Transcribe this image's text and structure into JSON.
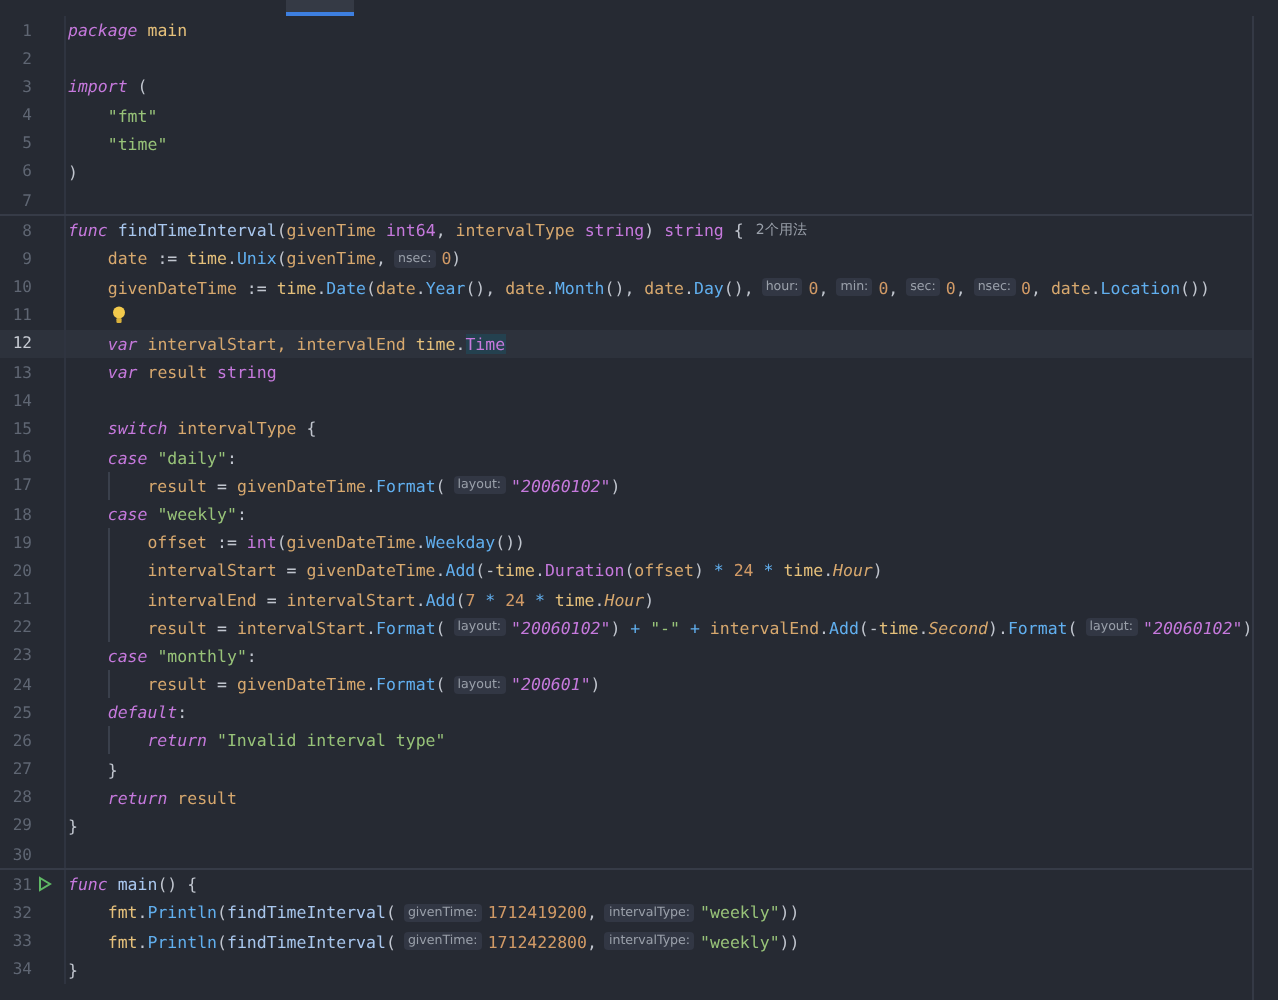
{
  "tab": {
    "selected": true
  },
  "blocks": [
    {
      "lines": [
        {
          "n": "1",
          "current": false,
          "tokens": [
            {
              "kind": "kw",
              "text": "package "
            },
            {
              "kind": "pk",
              "text": "main"
            }
          ]
        },
        {
          "n": "2",
          "current": false
        },
        {
          "n": "3",
          "current": false,
          "tokens": [
            {
              "kind": "kw",
              "text": "import "
            },
            {
              "kind": "pl",
              "text": "("
            }
          ],
          "children": [
            {
              "n": "4",
              "current": false,
              "tokens": [
                {
                  "kind": "str",
                  "text": "\"fmt\""
                }
              ]
            },
            {
              "n": "5",
              "current": false,
              "tokens": [
                {
                  "kind": "str",
                  "text": "\"time\""
                }
              ]
            }
          ]
        },
        {
          "n": "6",
          "current": false,
          "tokens": [
            {
              "kind": "pl",
              "text": ")"
            }
          ]
        },
        {
          "n": "7",
          "current": false
        }
      ]
    },
    {
      "lines": [
        {
          "n": "8",
          "current": false,
          "tokens": [
            {
              "kind": "kw",
              "text": "func "
            },
            {
              "kind": "decl",
              "text": "findTimeInterval"
            },
            {
              "kind": "pl",
              "text": "("
            },
            {
              "kind": "var",
              "text": "givenTime "
            },
            {
              "kind": "ty",
              "text": "int64"
            },
            {
              "kind": "pl",
              "text": ", "
            },
            {
              "kind": "var",
              "text": "intervalType "
            },
            {
              "kind": "ty",
              "text": "string"
            },
            {
              "kind": "pl",
              "text": ") "
            },
            {
              "kind": "ty",
              "text": "string "
            },
            {
              "kind": "pl",
              "text": "{"
            },
            {
              "kind": "usage",
              "text": "2个用法"
            }
          ],
          "children": [
            {
              "n": "9",
              "current": false,
              "tokens": [
                {
                  "kind": "var",
                  "text": "date "
                },
                {
                  "kind": "pl",
                  "text": ":= "
                },
                {
                  "kind": "pk",
                  "text": "time"
                },
                {
                  "kind": "pl",
                  "text": "."
                },
                {
                  "kind": "fn",
                  "text": "Unix"
                },
                {
                  "kind": "pl",
                  "text": "("
                },
                {
                  "kind": "var",
                  "text": "givenTime"
                },
                {
                  "kind": "pl",
                  "text": ","
                },
                {
                  "kind": "hint",
                  "text": "nsec:"
                },
                {
                  "kind": "num",
                  "text": "0"
                },
                {
                  "kind": "pl",
                  "text": ")"
                }
              ]
            },
            {
              "n": "10",
              "current": false,
              "tokens": [
                {
                  "kind": "var",
                  "text": "givenDateTime "
                },
                {
                  "kind": "pl",
                  "text": ":= "
                },
                {
                  "kind": "pk",
                  "text": "time"
                },
                {
                  "kind": "pl",
                  "text": "."
                },
                {
                  "kind": "fn",
                  "text": "Date"
                },
                {
                  "kind": "pl",
                  "text": "("
                },
                {
                  "kind": "var",
                  "text": "date"
                },
                {
                  "kind": "pl",
                  "text": "."
                },
                {
                  "kind": "fn",
                  "text": "Year"
                },
                {
                  "kind": "pl",
                  "text": "(), "
                },
                {
                  "kind": "var",
                  "text": "date"
                },
                {
                  "kind": "pl",
                  "text": "."
                },
                {
                  "kind": "fn",
                  "text": "Month"
                },
                {
                  "kind": "pl",
                  "text": "(), "
                },
                {
                  "kind": "var",
                  "text": "date"
                },
                {
                  "kind": "pl",
                  "text": "."
                },
                {
                  "kind": "fn",
                  "text": "Day"
                },
                {
                  "kind": "pl",
                  "text": "(),"
                },
                {
                  "kind": "hint",
                  "text": "hour:"
                },
                {
                  "kind": "num",
                  "text": "0"
                },
                {
                  "kind": "pl",
                  "text": ","
                },
                {
                  "kind": "hint",
                  "text": "min:"
                },
                {
                  "kind": "num",
                  "text": "0"
                },
                {
                  "kind": "pl",
                  "text": ","
                },
                {
                  "kind": "hint",
                  "text": "sec:"
                },
                {
                  "kind": "num",
                  "text": "0"
                },
                {
                  "kind": "pl",
                  "text": ","
                },
                {
                  "kind": "hint",
                  "text": "nsec:"
                },
                {
                  "kind": "num",
                  "text": "0"
                },
                {
                  "kind": "pl",
                  "text": ", "
                },
                {
                  "kind": "var",
                  "text": "date"
                },
                {
                  "kind": "pl",
                  "text": "."
                },
                {
                  "kind": "fn",
                  "text": "Location"
                },
                {
                  "kind": "pl",
                  "text": "())"
                }
              ]
            },
            {
              "n": "11",
              "current": false,
              "kind": "bulb"
            },
            {
              "n": "12",
              "current": true,
              "tokens": [
                {
                  "kind": "kw",
                  "text": "var "
                },
                {
                  "kind": "var",
                  "text": "intervalStart, intervalEnd "
                },
                {
                  "kind": "pk",
                  "text": "time"
                },
                {
                  "kind": "pl",
                  "text": "."
                },
                {
                  "kind": "tyhl",
                  "text": "Time"
                }
              ]
            },
            {
              "n": "13",
              "current": false,
              "tokens": [
                {
                  "kind": "kw",
                  "text": "var "
                },
                {
                  "kind": "var",
                  "text": "result "
                },
                {
                  "kind": "ty",
                  "text": "string"
                }
              ]
            },
            {
              "n": "14",
              "current": false
            },
            {
              "n": "15",
              "current": false,
              "tokens": [
                {
                  "kind": "kw",
                  "text": "switch "
                },
                {
                  "kind": "var",
                  "text": "intervalType "
                },
                {
                  "kind": "pl",
                  "text": "{"
                }
              ]
            },
            {
              "n": "16",
              "current": false,
              "tokens": [
                {
                  "kind": "kw",
                  "text": "case "
                },
                {
                  "kind": "str",
                  "text": "\"daily\""
                },
                {
                  "kind": "pl",
                  "text": ":"
                }
              ],
              "children": [
                {
                  "n": "17",
                  "current": false,
                  "tokens": [
                    {
                      "kind": "var",
                      "text": "result "
                    },
                    {
                      "kind": "pl",
                      "text": "= "
                    },
                    {
                      "kind": "var",
                      "text": "givenDateTime"
                    },
                    {
                      "kind": "pl",
                      "text": "."
                    },
                    {
                      "kind": "fn",
                      "text": "Format"
                    },
                    {
                      "kind": "pl",
                      "text": "("
                    },
                    {
                      "kind": "hint",
                      "text": "layout:"
                    },
                    {
                      "kind": "fstr",
                      "text": "\"20060102\""
                    },
                    {
                      "kind": "pl",
                      "text": ")"
                    }
                  ]
                }
              ]
            },
            {
              "n": "18",
              "current": false,
              "tokens": [
                {
                  "kind": "kw",
                  "text": "case "
                },
                {
                  "kind": "str",
                  "text": "\"weekly\""
                },
                {
                  "kind": "pl",
                  "text": ":"
                }
              ],
              "children": [
                {
                  "n": "19",
                  "current": false,
                  "tokens": [
                    {
                      "kind": "var",
                      "text": "offset "
                    },
                    {
                      "kind": "pl",
                      "text": ":= "
                    },
                    {
                      "kind": "ty",
                      "text": "int"
                    },
                    {
                      "kind": "pl",
                      "text": "("
                    },
                    {
                      "kind": "var",
                      "text": "givenDateTime"
                    },
                    {
                      "kind": "pl",
                      "text": "."
                    },
                    {
                      "kind": "fn",
                      "text": "Weekday"
                    },
                    {
                      "kind": "pl",
                      "text": "())"
                    }
                  ]
                },
                {
                  "n": "20",
                  "current": false,
                  "tokens": [
                    {
                      "kind": "var",
                      "text": "intervalStart "
                    },
                    {
                      "kind": "pl",
                      "text": "= "
                    },
                    {
                      "kind": "var",
                      "text": "givenDateTime"
                    },
                    {
                      "kind": "pl",
                      "text": "."
                    },
                    {
                      "kind": "fn",
                      "text": "Add"
                    },
                    {
                      "kind": "pl",
                      "text": "(-"
                    },
                    {
                      "kind": "pk",
                      "text": "time"
                    },
                    {
                      "kind": "pl",
                      "text": "."
                    },
                    {
                      "kind": "ty",
                      "text": "Duration"
                    },
                    {
                      "kind": "pl",
                      "text": "("
                    },
                    {
                      "kind": "var",
                      "text": "offset"
                    },
                    {
                      "kind": "pl",
                      "text": ") "
                    },
                    {
                      "kind": "op",
                      "text": "* "
                    },
                    {
                      "kind": "num",
                      "text": "24 "
                    },
                    {
                      "kind": "op",
                      "text": "* "
                    },
                    {
                      "kind": "pk",
                      "text": "time"
                    },
                    {
                      "kind": "pl",
                      "text": "."
                    },
                    {
                      "kind": "con",
                      "text": "Hour"
                    },
                    {
                      "kind": "pl",
                      "text": ")"
                    }
                  ]
                },
                {
                  "n": "21",
                  "current": false,
                  "tokens": [
                    {
                      "kind": "var",
                      "text": "intervalEnd "
                    },
                    {
                      "kind": "pl",
                      "text": "= "
                    },
                    {
                      "kind": "var",
                      "text": "intervalStart"
                    },
                    {
                      "kind": "pl",
                      "text": "."
                    },
                    {
                      "kind": "fn",
                      "text": "Add"
                    },
                    {
                      "kind": "pl",
                      "text": "("
                    },
                    {
                      "kind": "num",
                      "text": "7 "
                    },
                    {
                      "kind": "op",
                      "text": "* "
                    },
                    {
                      "kind": "num",
                      "text": "24 "
                    },
                    {
                      "kind": "op",
                      "text": "* "
                    },
                    {
                      "kind": "pk",
                      "text": "time"
                    },
                    {
                      "kind": "pl",
                      "text": "."
                    },
                    {
                      "kind": "con",
                      "text": "Hour"
                    },
                    {
                      "kind": "pl",
                      "text": ")"
                    }
                  ]
                },
                {
                  "n": "22",
                  "current": false,
                  "tokens": [
                    {
                      "kind": "var",
                      "text": "result "
                    },
                    {
                      "kind": "pl",
                      "text": "= "
                    },
                    {
                      "kind": "var",
                      "text": "intervalStart"
                    },
                    {
                      "kind": "pl",
                      "text": "."
                    },
                    {
                      "kind": "fn",
                      "text": "Format"
                    },
                    {
                      "kind": "pl",
                      "text": "("
                    },
                    {
                      "kind": "hint",
                      "text": "layout:"
                    },
                    {
                      "kind": "fstr",
                      "text": "\"20060102\""
                    },
                    {
                      "kind": "pl",
                      "text": ") "
                    },
                    {
                      "kind": "op",
                      "text": "+ "
                    },
                    {
                      "kind": "str",
                      "text": "\"-\" "
                    },
                    {
                      "kind": "op",
                      "text": "+ "
                    },
                    {
                      "kind": "var",
                      "text": "intervalEnd"
                    },
                    {
                      "kind": "pl",
                      "text": "."
                    },
                    {
                      "kind": "fn",
                      "text": "Add"
                    },
                    {
                      "kind": "pl",
                      "text": "(-"
                    },
                    {
                      "kind": "pk",
                      "text": "time"
                    },
                    {
                      "kind": "pl",
                      "text": "."
                    },
                    {
                      "kind": "con",
                      "text": "Second"
                    },
                    {
                      "kind": "pl",
                      "text": ")."
                    },
                    {
                      "kind": "fn",
                      "text": "Format"
                    },
                    {
                      "kind": "pl",
                      "text": "("
                    },
                    {
                      "kind": "hint",
                      "text": "layout:"
                    },
                    {
                      "kind": "fstr",
                      "text": "\"20060102\""
                    },
                    {
                      "kind": "pl",
                      "text": ")"
                    }
                  ]
                }
              ]
            },
            {
              "n": "23",
              "current": false,
              "tokens": [
                {
                  "kind": "kw",
                  "text": "case "
                },
                {
                  "kind": "str",
                  "text": "\"monthly\""
                },
                {
                  "kind": "pl",
                  "text": ":"
                }
              ],
              "children": [
                {
                  "n": "24",
                  "current": false,
                  "tokens": [
                    {
                      "kind": "var",
                      "text": "result "
                    },
                    {
                      "kind": "pl",
                      "text": "= "
                    },
                    {
                      "kind": "var",
                      "text": "givenDateTime"
                    },
                    {
                      "kind": "pl",
                      "text": "."
                    },
                    {
                      "kind": "fn",
                      "text": "Format"
                    },
                    {
                      "kind": "pl",
                      "text": "("
                    },
                    {
                      "kind": "hint",
                      "text": "layout:"
                    },
                    {
                      "kind": "fstr",
                      "text": "\"200601\""
                    },
                    {
                      "kind": "pl",
                      "text": ")"
                    }
                  ]
                }
              ]
            },
            {
              "n": "25",
              "current": false,
              "tokens": [
                {
                  "kind": "kw",
                  "text": "default"
                },
                {
                  "kind": "pl",
                  "text": ":"
                }
              ],
              "children": [
                {
                  "n": "26",
                  "current": false,
                  "tokens": [
                    {
                      "kind": "kw",
                      "text": "return "
                    },
                    {
                      "kind": "str",
                      "text": "\"Invalid interval type\""
                    }
                  ]
                }
              ]
            },
            {
              "n": "27",
              "current": false,
              "tokens": [
                {
                  "kind": "pl",
                  "text": "}"
                }
              ]
            },
            {
              "n": "28",
              "current": false,
              "tokens": [
                {
                  "kind": "kw",
                  "text": "return "
                },
                {
                  "kind": "var",
                  "text": "result"
                }
              ]
            }
          ]
        },
        {
          "n": "29",
          "current": false,
          "tokens": [
            {
              "kind": "pl",
              "text": "}"
            }
          ]
        },
        {
          "n": "30",
          "current": false
        }
      ]
    },
    {
      "lines": [
        {
          "n": "31",
          "current": false,
          "kind": "run",
          "tokens": [
            {
              "kind": "kw",
              "text": "func "
            },
            {
              "kind": "decl",
              "text": "main"
            },
            {
              "kind": "pl",
              "text": "() {"
            }
          ],
          "children": [
            {
              "n": "32",
              "current": false,
              "tokens": [
                {
                  "kind": "pk",
                  "text": "fmt"
                },
                {
                  "kind": "pl",
                  "text": "."
                },
                {
                  "kind": "fn",
                  "text": "Println"
                },
                {
                  "kind": "pl",
                  "text": "("
                },
                {
                  "kind": "decl",
                  "text": "findTimeInterval"
                },
                {
                  "kind": "pl",
                  "text": "("
                },
                {
                  "kind": "hint",
                  "text": "givenTime:"
                },
                {
                  "kind": "num",
                  "text": "1712419200"
                },
                {
                  "kind": "pl",
                  "text": ","
                },
                {
                  "kind": "hint",
                  "text": "intervalType:"
                },
                {
                  "kind": "str",
                  "text": "\"weekly\""
                },
                {
                  "kind": "pl",
                  "text": "))"
                }
              ]
            },
            {
              "n": "33",
              "current": false,
              "tokens": [
                {
                  "kind": "pk",
                  "text": "fmt"
                },
                {
                  "kind": "pl",
                  "text": "."
                },
                {
                  "kind": "fn",
                  "text": "Println"
                },
                {
                  "kind": "pl",
                  "text": "("
                },
                {
                  "kind": "decl",
                  "text": "findTimeInterval"
                },
                {
                  "kind": "pl",
                  "text": "("
                },
                {
                  "kind": "hint",
                  "text": "givenTime:"
                },
                {
                  "kind": "num",
                  "text": "1712422800"
                },
                {
                  "kind": "pl",
                  "text": ","
                },
                {
                  "kind": "hint",
                  "text": "intervalType:"
                },
                {
                  "kind": "str",
                  "text": "\"weekly\""
                },
                {
                  "kind": "pl",
                  "text": "))"
                }
              ]
            }
          ]
        },
        {
          "n": "34",
          "current": false,
          "tokens": [
            {
              "kind": "pl",
              "text": "}"
            }
          ]
        }
      ]
    }
  ]
}
